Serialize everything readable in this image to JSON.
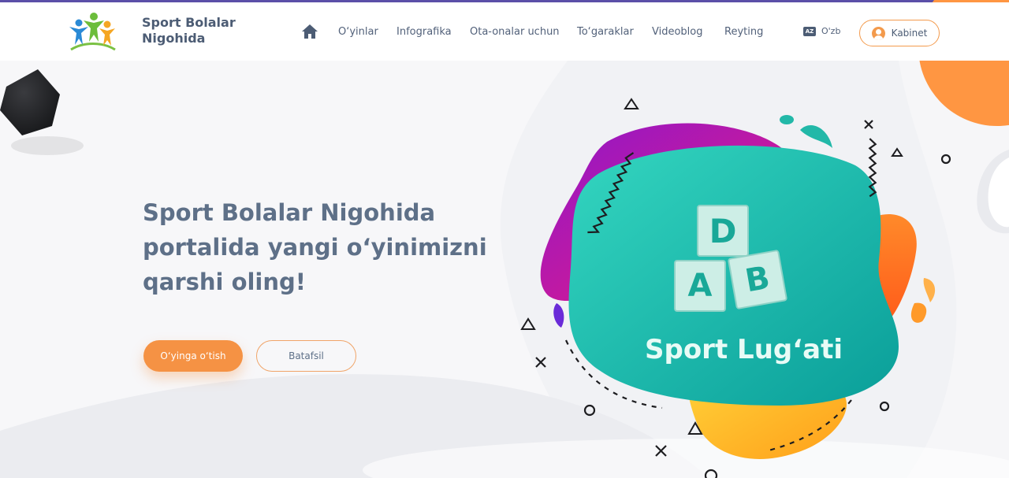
{
  "header": {
    "brand_line1": "Sport Bolalar",
    "brand_line2": "Nigohida",
    "nav_items": [
      "O‘yinlar",
      "Infografika",
      "Ota-onalar uchun",
      "To‘garaklar",
      "Videoblog",
      "Reyting"
    ],
    "lang_label": "O'zb",
    "lang_icon_text": "AZ",
    "kabinet_label": "Kabinet"
  },
  "hero": {
    "headline_line1": "Sport Bolalar Nigohida",
    "headline_line2": "portalida yangi o‘yinimizni",
    "headline_line3": "qarshi oling!",
    "primary_button": "O‘yinga o‘tish",
    "secondary_button": "Batafsil"
  },
  "illustration": {
    "title": "Sport Lug‘ati",
    "blocks": [
      "D",
      "A",
      "B"
    ]
  },
  "colors": {
    "accent": "#f59244",
    "text": "#5e7088",
    "teal": "#20b9a8",
    "magenta": "#d0129a",
    "top_bar": "#5b4fa8"
  },
  "icons": [
    "home-icon",
    "language-icon",
    "user-icon",
    "logo-icon"
  ]
}
